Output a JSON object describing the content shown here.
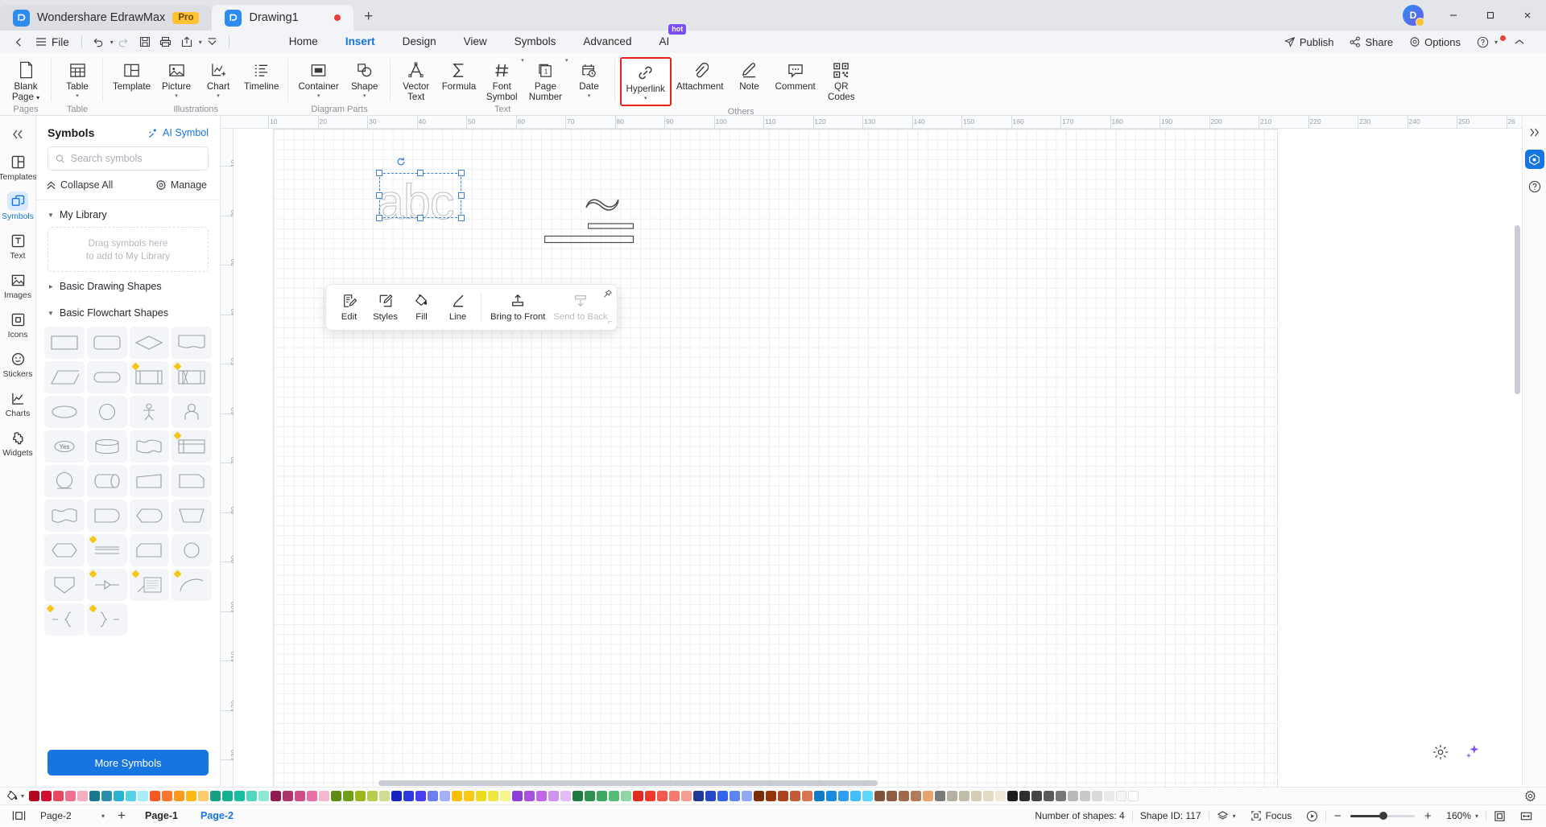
{
  "titlebar": {
    "app_name": "Wondershare EdrawMax",
    "pro_badge": "Pro",
    "doc_tab": "Drawing1",
    "new_tab_icon": "plus-icon",
    "avatar_initial": "D",
    "minimize_icon": "minimize-icon",
    "maximize_icon": "maximize-icon",
    "close_icon": "close-icon"
  },
  "menubar": {
    "back_icon": "chevron-left-icon",
    "hamburger_icon": "hamburger-icon",
    "file_label": "File",
    "undo_icon": "undo-icon",
    "redo_icon": "redo-icon",
    "save_icon": "save-icon",
    "print_icon": "print-icon",
    "export_icon": "export-icon",
    "customize_icon": "chevron-down-icon",
    "tabs": [
      {
        "label": "Home",
        "active": false
      },
      {
        "label": "Insert",
        "active": true
      },
      {
        "label": "Design",
        "active": false
      },
      {
        "label": "View",
        "active": false
      },
      {
        "label": "Symbols",
        "active": false
      },
      {
        "label": "Advanced",
        "active": false
      },
      {
        "label": "AI",
        "active": false,
        "badge": "hot"
      }
    ],
    "right": {
      "publish": "Publish",
      "share": "Share",
      "options": "Options",
      "help_icon": "help-circle-icon",
      "collapse_icon": "chevron-up-icon"
    }
  },
  "ribbon": {
    "groups": [
      {
        "label": "Pages",
        "items": [
          {
            "label": "Blank\nPage",
            "icon": "blank-page-icon",
            "dropdown": "inline",
            "name": "blank-page"
          }
        ]
      },
      {
        "label": "Table",
        "items": [
          {
            "label": "Table",
            "icon": "table-icon",
            "dropdown": "below",
            "name": "table"
          }
        ]
      },
      {
        "label": "Illustrations",
        "items": [
          {
            "label": "Template",
            "icon": "template-icon",
            "name": "template"
          },
          {
            "label": "Picture",
            "icon": "picture-icon",
            "dropdown": "below",
            "name": "picture"
          },
          {
            "label": "Chart",
            "icon": "chart-icon",
            "dropdown": "below",
            "name": "chart"
          },
          {
            "label": "Timeline",
            "icon": "timeline-icon",
            "name": "timeline"
          }
        ]
      },
      {
        "label": "Diagram Parts",
        "items": [
          {
            "label": "Container",
            "icon": "container-icon",
            "dropdown": "below",
            "name": "container"
          },
          {
            "label": "Shape",
            "icon": "shape-icon",
            "dropdown": "below",
            "name": "shape"
          }
        ]
      },
      {
        "label": "Text",
        "items": [
          {
            "label": "Vector\nText",
            "icon": "vector-text-icon",
            "name": "vector-text"
          },
          {
            "label": "Formula",
            "icon": "formula-icon",
            "name": "formula"
          },
          {
            "label": "Font\nSymbol",
            "icon": "font-symbol-icon",
            "dropdown": "inline",
            "name": "font-symbol"
          },
          {
            "label": "Page\nNumber",
            "icon": "page-number-icon",
            "dropdown": "inline",
            "name": "page-number"
          },
          {
            "label": "Date",
            "icon": "date-icon",
            "dropdown": "below",
            "name": "date"
          }
        ]
      },
      {
        "label": "Others",
        "items": [
          {
            "label": "Hyperlink",
            "icon": "hyperlink-icon",
            "dropdown": "below",
            "name": "hyperlink",
            "highlighted": true
          },
          {
            "label": "Attachment",
            "icon": "attachment-icon",
            "name": "attachment"
          },
          {
            "label": "Note",
            "icon": "note-icon",
            "name": "note"
          },
          {
            "label": "Comment",
            "icon": "comment-icon",
            "name": "comment"
          },
          {
            "label": "QR\nCodes",
            "icon": "qr-code-icon",
            "name": "qr-codes"
          }
        ]
      }
    ],
    "highlight_color": "#e8201b"
  },
  "rail": {
    "collapse_icon": "double-chevron-left-icon",
    "items": [
      {
        "label": "Templates",
        "icon": "templates-icon",
        "active": false
      },
      {
        "label": "Symbols",
        "icon": "symbols-icon",
        "active": true
      },
      {
        "label": "Text",
        "icon": "text-icon",
        "active": false
      },
      {
        "label": "Images",
        "icon": "images-icon",
        "active": false
      },
      {
        "label": "Icons",
        "icon": "icons-icon",
        "active": false
      },
      {
        "label": "Stickers",
        "icon": "stickers-icon",
        "active": false
      },
      {
        "label": "Charts",
        "icon": "charts-icon",
        "active": false
      },
      {
        "label": "Widgets",
        "icon": "widgets-icon",
        "active": false
      }
    ]
  },
  "panel": {
    "title": "Symbols",
    "ai_symbol": "AI Symbol",
    "search_placeholder": "Search symbols",
    "search_value": "",
    "collapse_all": "Collapse All",
    "manage": "Manage",
    "sections": [
      {
        "label": "My Library",
        "expanded": true
      },
      {
        "label": "Basic Drawing Shapes",
        "expanded": false
      },
      {
        "label": "Basic Flowchart Shapes",
        "expanded": true
      }
    ],
    "dropzone_line1": "Drag symbols here",
    "dropzone_line2": "to add to My Library",
    "yes_shape_label": "Yes",
    "more_symbols": "More Symbols"
  },
  "canvas": {
    "selected_text": "abc",
    "rotate_handle_icon": "rotate-icon",
    "ruler_h_ticks": [
      "10",
      "20",
      "30",
      "40",
      "50",
      "60",
      "70",
      "80",
      "90",
      "100",
      "110",
      "120",
      "130",
      "140",
      "150",
      "160",
      "170",
      "180",
      "190",
      "200",
      "210",
      "220",
      "230",
      "240",
      "250",
      "26"
    ],
    "ruler_v_ticks": [
      "10",
      "20",
      "30",
      "40",
      "50",
      "60",
      "70",
      "80",
      "90",
      "100",
      "110",
      "120",
      "130"
    ],
    "mini_toolbar": {
      "items": [
        {
          "label": "Edit",
          "icon": "edit-icon",
          "disabled": false
        },
        {
          "label": "Styles",
          "icon": "styles-icon",
          "disabled": false
        },
        {
          "label": "Fill",
          "icon": "fill-icon",
          "disabled": false
        },
        {
          "label": "Line",
          "icon": "line-icon",
          "disabled": false
        },
        {
          "label": "Bring to Front",
          "icon": "bring-to-front-icon",
          "disabled": false
        },
        {
          "label": "Send to Back",
          "icon": "send-to-back-icon",
          "disabled": true
        }
      ],
      "pin_icon": "pin-icon",
      "resize_icon": "resize-grip-icon"
    }
  },
  "right_rail": {
    "collapse_icon": "double-chevron-right-icon",
    "format_icon": "format-panel-icon",
    "help_icon": "help-circle-icon"
  },
  "fab": {
    "effects_icon": "effects-icon",
    "ai_icon": "ai-sparkle-icon"
  },
  "colorbar": {
    "fill_icon": "paint-bucket-icon",
    "settings_icon": "gear-icon",
    "swatches": [
      "#b3061f",
      "#d10f33",
      "#e8475f",
      "#ef7191",
      "#f4aec1",
      "#18788f",
      "#2a8fad",
      "#29b3d2",
      "#55d2e8",
      "#a8ecf7",
      "#f45a21",
      "#f9762b",
      "#fb9a1c",
      "#fcb916",
      "#f9cd6a",
      "#16a085",
      "#13b08e",
      "#17bfa0",
      "#53d6bd",
      "#8ee8d3",
      "#8e1a52",
      "#b0346c",
      "#d04c86",
      "#e86fa8",
      "#f1b8d0",
      "#5d8c14",
      "#6fa01a",
      "#9ab81c",
      "#b8cc4e",
      "#cfdc94",
      "#1724c4",
      "#2c3ae0",
      "#4a3ef0",
      "#6d7cf0",
      "#a3b0f5",
      "#f9bf09",
      "#f7c919",
      "#eedb1c",
      "#f0e640",
      "#f8f490",
      "#8b3fd8",
      "#a851e2",
      "#c267e8",
      "#cf92ef",
      "#e2bdf5",
      "#1e7a40",
      "#2e9150",
      "#3fa860",
      "#55bd77",
      "#8fd6a4",
      "#e02b20",
      "#ee3a2c",
      "#f2584c",
      "#f6796f",
      "#f89d92",
      "#1c3a96",
      "#2647c6",
      "#3463ee",
      "#5c84f3",
      "#8fa9f5",
      "#7a2c06",
      "#933409",
      "#a9441c",
      "#c65a38",
      "#da7450",
      "#0f7ac8",
      "#1a8ade",
      "#2f9df0",
      "#40c0f7",
      "#5fd9fb",
      "#80513a",
      "#8f5c42",
      "#a06a4a",
      "#b37a58",
      "#e8a46f",
      "#7a7a7a",
      "#b4b0a3",
      "#c2bda9",
      "#d4cdb3",
      "#e3dcc5",
      "#efe9d7",
      "#1c1c1c",
      "#2e2e2e",
      "#454545",
      "#5a5a5a",
      "#777777",
      "#b9b9b9",
      "#c9c9c9",
      "#dadada",
      "#eaeaea",
      "#f5f5f5",
      "#ffffff"
    ]
  },
  "statusbar": {
    "view_icon": "page-view-icon",
    "page_selector_value": "Page-2",
    "add_page_icon": "plus-icon",
    "page_tabs": [
      {
        "label": "Page-1",
        "active": false
      },
      {
        "label": "Page-2",
        "active": true
      }
    ],
    "shape_count": "Number of shapes: 4",
    "shape_id": "Shape ID: 117",
    "layers_icon": "layers-icon",
    "focus_label": "Focus",
    "focus_icon": "focus-icon",
    "play_icon": "play-circle-icon",
    "zoom_minus": "−",
    "zoom_plus": "+",
    "zoom_value": "160%",
    "fit_page_icon": "fit-page-icon",
    "fit_width_icon": "fit-width-icon"
  }
}
